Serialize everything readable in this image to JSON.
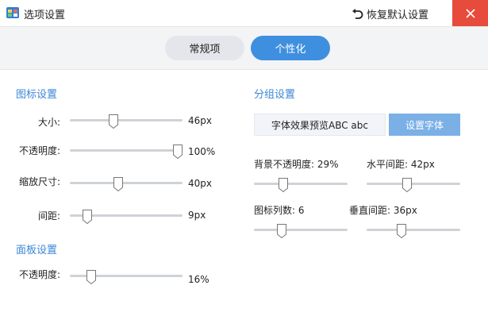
{
  "window": {
    "title": "选项设置",
    "restore_label": "恢复默认设置",
    "accent": "#3f8fe0",
    "close_color": "#e64b3c"
  },
  "tabs": [
    {
      "label": "常规项",
      "active": false
    },
    {
      "label": "个性化",
      "active": true
    }
  ],
  "icon_settings": {
    "title": "图标设置",
    "rows": [
      {
        "label": "大小:",
        "value": "46px",
        "level": 0.38
      },
      {
        "label": "不透明度:",
        "value": "100%",
        "level": 1.0
      },
      {
        "label": "缩放尺寸:",
        "value": "40px",
        "level": 0.42
      },
      {
        "label": "间距:",
        "value": "9px",
        "level": 0.12
      }
    ]
  },
  "panel_settings": {
    "title": "面板设置",
    "rows": [
      {
        "label": "不透明度:",
        "value": "16%",
        "level": 0.16
      }
    ]
  },
  "group_settings": {
    "title": "分组设置",
    "preview_text": "字体效果预览ABC abc",
    "set_font_label": "设置字体",
    "bg_opacity": {
      "label": "背景不透明度: 29%",
      "level": 0.29
    },
    "h_spacing": {
      "label": "水平间距: 42px",
      "level": 0.42
    },
    "icon_cols": {
      "label": "图标列数: 6",
      "level": 0.27
    },
    "v_spacing": {
      "label": "垂直间距: 36px",
      "level": 0.36
    }
  }
}
